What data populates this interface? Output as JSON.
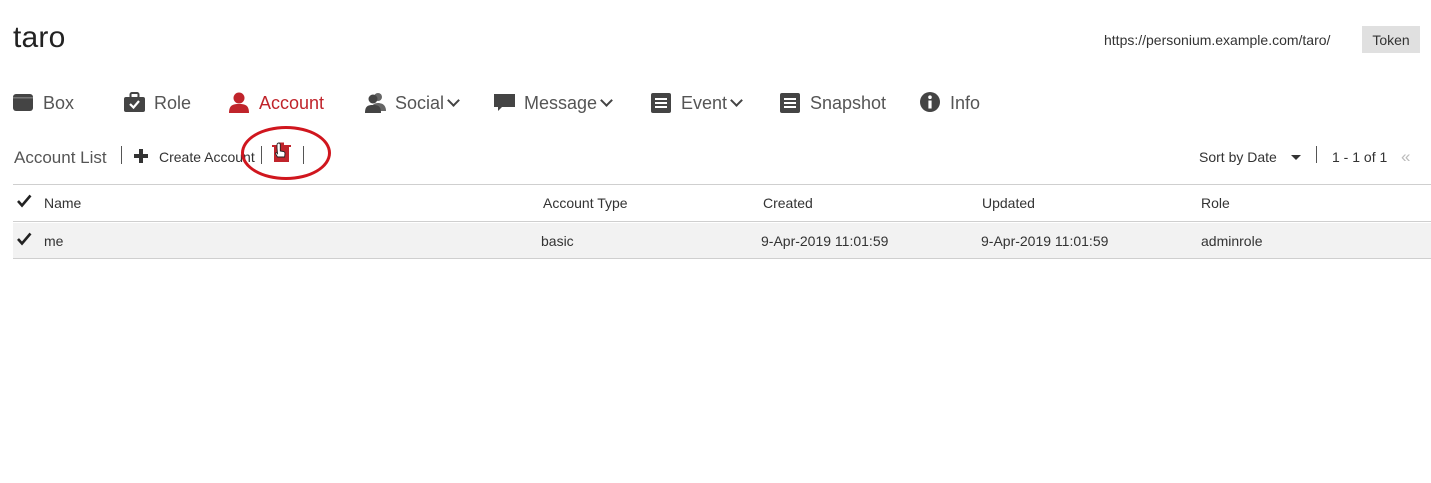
{
  "header": {
    "cell_name": "taro",
    "url": "https://personium.example.com/taro/",
    "token_label": "Token"
  },
  "nav": {
    "box": "Box",
    "role": "Role",
    "account": "Account",
    "social": "Social",
    "message": "Message",
    "event": "Event",
    "snapshot": "Snapshot",
    "info": "Info"
  },
  "toolbar": {
    "title": "Account List",
    "create_label": "Create Account",
    "sort_label": "Sort by Date",
    "pagination": "1 - 1 of 1",
    "first_page_icon": "«"
  },
  "table": {
    "headers": {
      "name": "Name",
      "account_type": "Account Type",
      "created": "Created",
      "updated": "Updated",
      "role": "Role"
    },
    "rows": [
      {
        "name": "me",
        "account_type": "basic",
        "created": "9-Apr-2019 11:01:59",
        "updated": "9-Apr-2019 11:01:59",
        "role": "adminrole",
        "checked": true
      }
    ]
  },
  "colors": {
    "accent": "#c0242b",
    "highlight_circle": "#d0161e",
    "row_selected": "#f2f2f2"
  }
}
